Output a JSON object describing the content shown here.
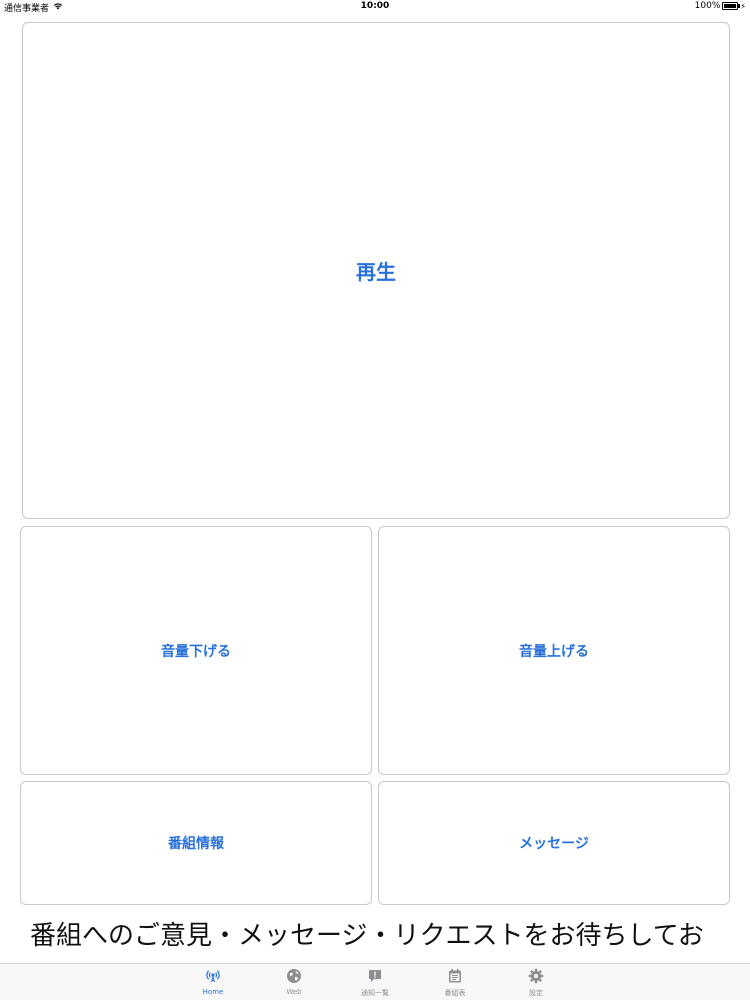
{
  "status_bar": {
    "carrier": "通信事業者",
    "time": "10:00",
    "battery": "100%",
    "battery_level": 1.0
  },
  "buttons": {
    "play": "再生",
    "volume_down": "音量下げる",
    "volume_up": "音量上げる",
    "program_info": "番組情報",
    "message": "メッセージ"
  },
  "marquee": {
    "text": "番組へのご意見・メッセージ・リクエストをお待ちしてお"
  },
  "tabs": [
    {
      "label": "Home",
      "icon": "radio-antenna-icon",
      "active": true
    },
    {
      "label": "Web",
      "icon": "globe-icon",
      "active": false
    },
    {
      "label": "通知一覧",
      "icon": "notification-icon",
      "active": false
    },
    {
      "label": "番組表",
      "icon": "calendar-icon",
      "active": false
    },
    {
      "label": "設定",
      "icon": "gear-icon",
      "active": false
    }
  ],
  "colors": {
    "accent": "#2a72d9",
    "inactive": "#8e8e93",
    "border": "#c9c7cc"
  }
}
